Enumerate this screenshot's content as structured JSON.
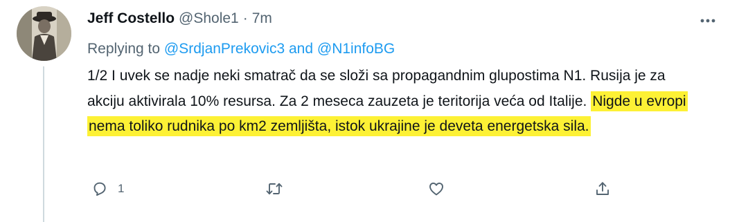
{
  "tweet": {
    "author": {
      "display_name": "Jeff Costello",
      "handle": "@Shole1"
    },
    "separator": "·",
    "time": "7m",
    "replying_prefix": "Replying to",
    "replying_mention_1": "@SrdjanPrekovic3",
    "replying_and": "and",
    "replying_mention_2": "@N1infoBG",
    "text_plain": "1/2 I uvek se nadje neki smatrač da se složi sa propagandnim glupostima N1. Rusija je za akciju aktivirala 10% resursa. Za 2 meseca zauzeta je teritorija veća od Italije.",
    "text_highlighted": "Nigde u evropi nema toliko rudnika po km2 zemljišta, istok ukrajine je deveta energetska sila.",
    "reply_count": "1",
    "icons": {
      "reply": "reply-icon",
      "retweet": "retweet-icon",
      "like": "heart-icon",
      "share": "share-icon",
      "more": "more-icon"
    },
    "colors": {
      "text": "#0f1419",
      "secondary": "#536471",
      "accent": "#1d9bf0",
      "highlight": "#fdf135"
    }
  }
}
